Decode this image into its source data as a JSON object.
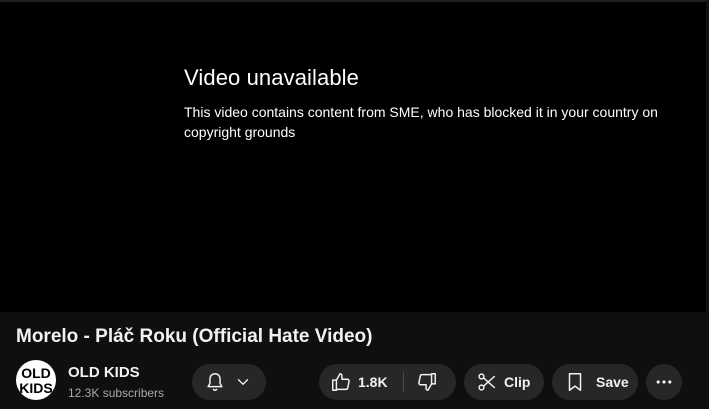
{
  "player": {
    "error_title": "Video unavailable",
    "error_message": "This video contains content from SME, who has blocked it in your country on copyright grounds"
  },
  "video": {
    "title": "Morelo - Pláč Roku (Official Hate Video)"
  },
  "channel": {
    "name": "OLD KIDS",
    "subscribers": "12.3K subscribers",
    "avatar_text": "OLD KIDS"
  },
  "actions": {
    "like_count": "1.8K",
    "clip_label": "Clip",
    "save_label": "Save"
  },
  "icons": {
    "bell": "bell-icon",
    "chevron": "chevron-down-icon",
    "like": "thumbs-up-icon",
    "dislike": "thumbs-down-icon",
    "clip": "scissors-icon",
    "save": "bookmark-icon",
    "more": "more-horizontal-icon"
  },
  "colors": {
    "background": "#0f0f0f",
    "player": "#000000",
    "pill": "#272727",
    "text": "#f1f1f1",
    "secondary_text": "#aaaaaa"
  }
}
